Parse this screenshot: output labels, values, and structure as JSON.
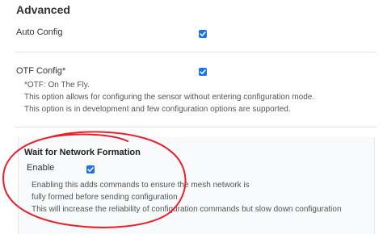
{
  "section": {
    "title": "Advanced"
  },
  "auto_config": {
    "label": "Auto Config",
    "checked": true
  },
  "otf_config": {
    "label": "OTF Config*",
    "checked": true,
    "help": [
      "*OTF: On The Fly.",
      "This option allows for configuring the sensor without entering configuration mode.",
      "This option is in development and few configuration options are supported."
    ]
  },
  "network_formation": {
    "title": "Wait for Network Formation",
    "enable_label": "Enable",
    "checked": true,
    "help": [
      "Enabling this adds commands to ensure the mesh network is",
      "fully formed before sending configuration",
      "This will increase the reliability of configuration commands but slow down configuration"
    ]
  },
  "colors": {
    "checkbox": "#1a73e8",
    "annotation": "#e8202a",
    "card_background": "#f8f9fa"
  }
}
